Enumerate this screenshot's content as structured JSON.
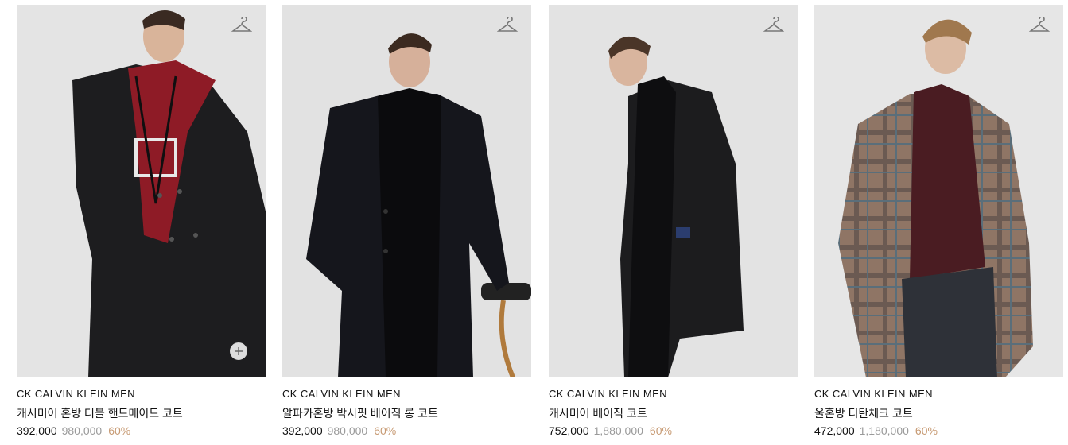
{
  "products": [
    {
      "brand": "CK CALVIN KLEIN MEN",
      "name": "캐시미어 혼방 더블 핸드메이드 코트",
      "sale_price": "392,000",
      "original_price": "980,000",
      "discount": "60%"
    },
    {
      "brand": "CK CALVIN KLEIN MEN",
      "name": "알파카혼방 박시핏 베이직 롱 코트",
      "sale_price": "392,000",
      "original_price": "980,000",
      "discount": "60%"
    },
    {
      "brand": "CK CALVIN KLEIN MEN",
      "name": "캐시미어 베이직 코트",
      "sale_price": "752,000",
      "original_price": "1,880,000",
      "discount": "60%"
    },
    {
      "brand": "CK CALVIN KLEIN MEN",
      "name": "울혼방 티탄체크 코트",
      "sale_price": "472,000",
      "original_price": "1,180,000",
      "discount": "60%"
    }
  ],
  "icons": {
    "wishlist": "hanger-icon",
    "quick_add": "plus-icon"
  },
  "colors": {
    "discount": "#c79a73",
    "original_price": "#9a9a9a",
    "image_background": "#e2e2e2"
  }
}
